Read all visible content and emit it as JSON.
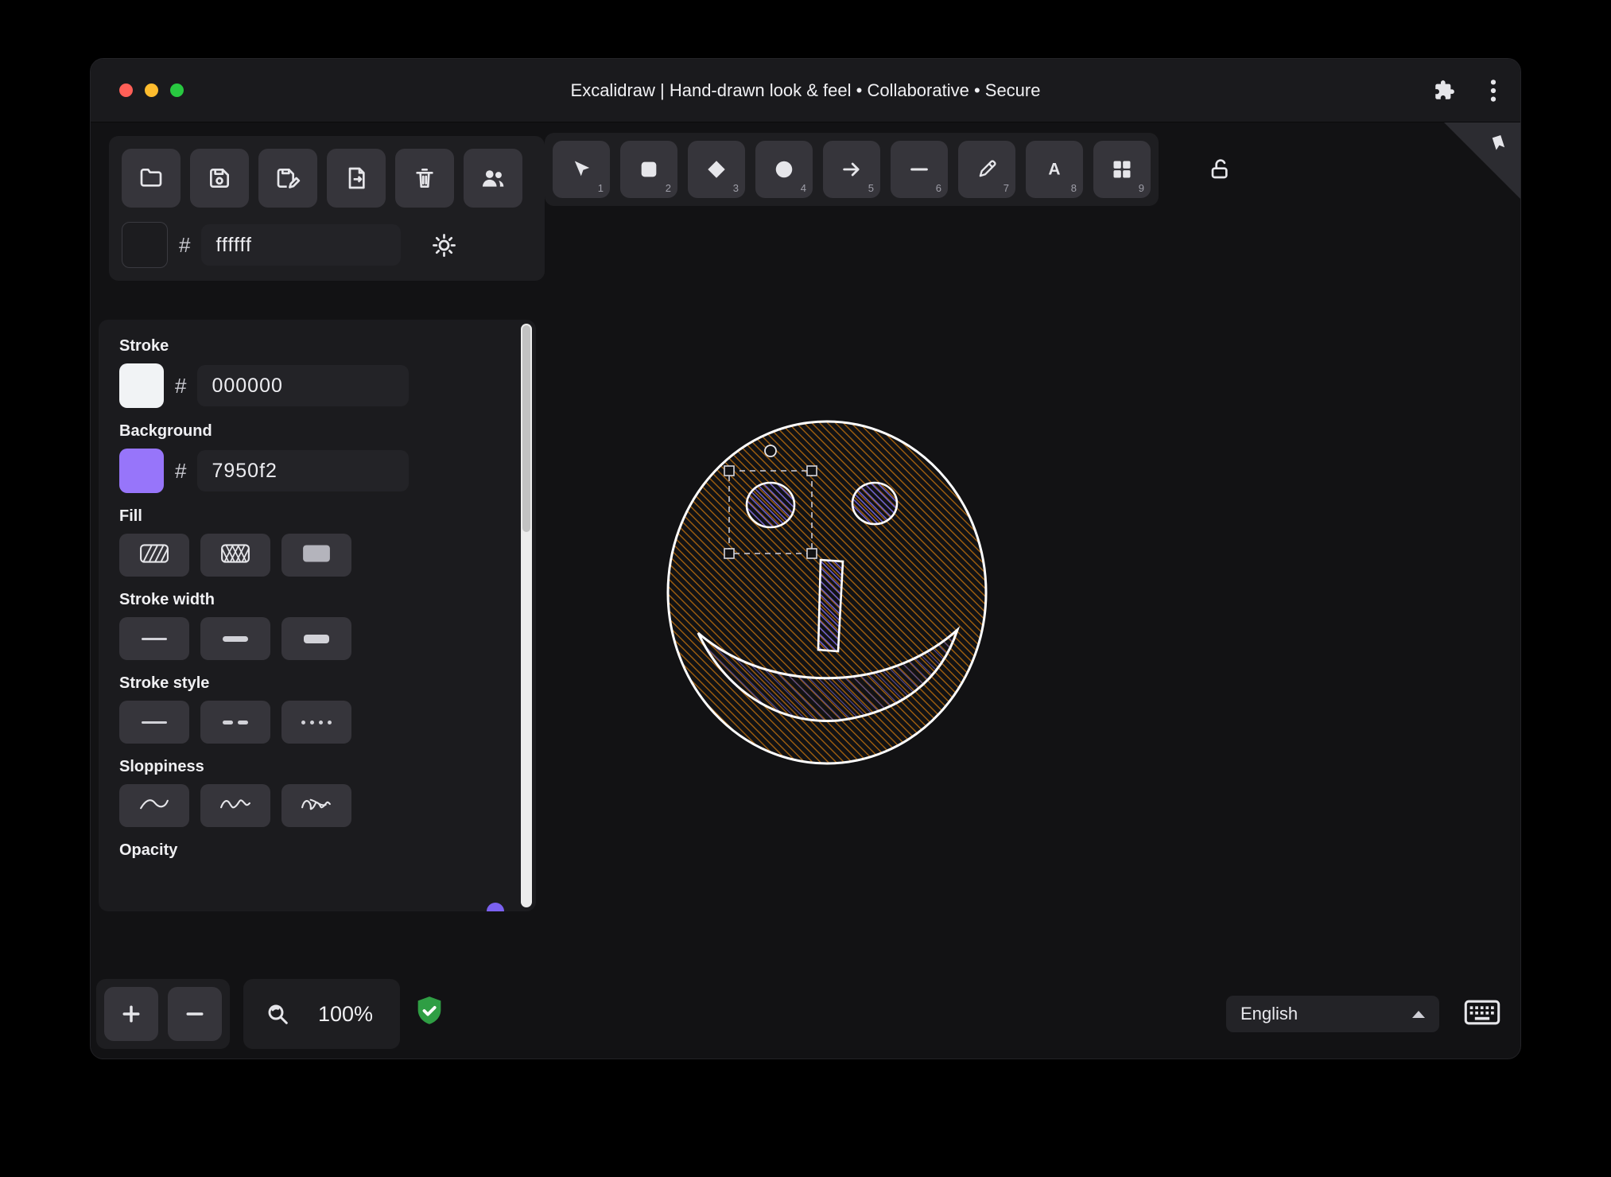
{
  "titlebar": {
    "title": "Excalidraw | Hand-drawn look & feel • Collaborative • Secure"
  },
  "top_toolbar": {
    "icons": [
      "folder-open-icon",
      "save-icon",
      "save-as-icon",
      "export-icon",
      "trash-icon",
      "collaborators-icon"
    ]
  },
  "canvas_color": {
    "hash": "#",
    "value": "ffffff"
  },
  "tools": [
    {
      "name": "selection",
      "shortcut": "1"
    },
    {
      "name": "rectangle",
      "shortcut": "2"
    },
    {
      "name": "diamond",
      "shortcut": "3"
    },
    {
      "name": "ellipse",
      "shortcut": "4"
    },
    {
      "name": "arrow",
      "shortcut": "5"
    },
    {
      "name": "line",
      "shortcut": "6"
    },
    {
      "name": "draw",
      "shortcut": "7"
    },
    {
      "name": "text",
      "shortcut": "8"
    },
    {
      "name": "shapes",
      "shortcut": "9"
    }
  ],
  "properties_panel": {
    "stroke": {
      "label": "Stroke",
      "hash": "#",
      "value": "000000",
      "swatch": "#f1f3f5"
    },
    "background": {
      "label": "Background",
      "hash": "#",
      "value": "7950f2",
      "swatch": "#9775fa"
    },
    "fill": {
      "label": "Fill"
    },
    "stroke_width": {
      "label": "Stroke width"
    },
    "stroke_style": {
      "label": "Stroke style"
    },
    "sloppiness": {
      "label": "Sloppiness"
    },
    "opacity": {
      "label": "Opacity"
    }
  },
  "footer": {
    "zoom": "100%",
    "language": "English"
  },
  "colors": {
    "accent": "#7950f2",
    "face_hatch": "#a2600f",
    "eye_hatch": "#6b5fcf",
    "shield_green": "#2f9e44"
  }
}
